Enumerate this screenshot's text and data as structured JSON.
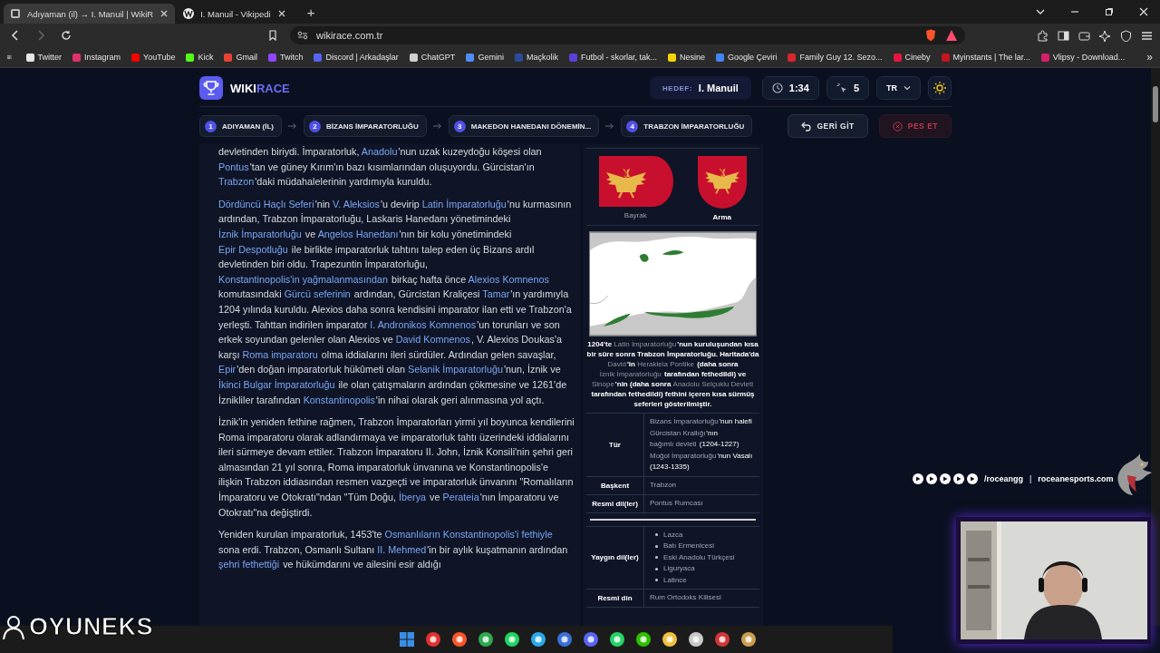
{
  "browser": {
    "tabs": [
      {
        "title": "Adıyaman (il) → I. Manuil | WikiR",
        "kind": "race",
        "selected": true
      },
      {
        "title": "I. Manuil - Vikipedi",
        "kind": "wiki",
        "selected": false
      }
    ],
    "new_tab": "+",
    "address": "wikirace.com.tr",
    "bookmarks": [
      {
        "label": "Twitter",
        "color": "#e7e7e7"
      },
      {
        "label": "Instagram",
        "color": "#e1306c"
      },
      {
        "label": "YouTube",
        "color": "#ff0000"
      },
      {
        "label": "Kick",
        "color": "#53fc18"
      },
      {
        "label": "Gmail",
        "color": "#ea4335"
      },
      {
        "label": "Twitch",
        "color": "#9146ff"
      },
      {
        "label": "Discord | Arkadaşlar",
        "color": "#5865f2"
      },
      {
        "label": "ChatGPT",
        "color": "#d0d0d0"
      },
      {
        "label": "Gemini",
        "color": "#4f8df7"
      },
      {
        "label": "Maçkolik",
        "color": "#2b4c9b"
      },
      {
        "label": "Futbol - skorlar, tak...",
        "color": "#5b3fd6"
      },
      {
        "label": "Nesine",
        "color": "#f5d20a"
      },
      {
        "label": "Google Çeviri",
        "color": "#4285f4"
      },
      {
        "label": "Family Guy 12. Sezo...",
        "color": "#d7262f"
      },
      {
        "label": "Cineby",
        "color": "#e5173f"
      },
      {
        "label": "Myinstants | The lar...",
        "color": "#c4161c"
      },
      {
        "label": "Vlipsy - Download...",
        "color": "#d61f6b"
      }
    ],
    "more": "»"
  },
  "app": {
    "logo": {
      "prefix": "WIKI",
      "suffix": "RACE"
    },
    "target": {
      "label": "HEDEF:",
      "value": "I. Manuil"
    },
    "timer": "1:34",
    "clicks": "5",
    "language": "TR",
    "steps": [
      {
        "number": "1",
        "label": "ADIYAMAN (İL)"
      },
      {
        "number": "2",
        "label": "BİZANS İMPARATORLUĞU"
      },
      {
        "number": "3",
        "label": "MAKEDON HANEDANI DÖNEMİN..."
      },
      {
        "number": "4",
        "label": "TRABZON İMPARATORLUĞU"
      }
    ],
    "back_button": "GERİ GİT",
    "give_up_button": "PES ET"
  },
  "article": {
    "paragraphs": [
      [
        {
          "kind": "text",
          "text": "devletinden biriydi. İmparatorluk, "
        },
        {
          "kind": "link",
          "text": "Anadolu"
        },
        {
          "kind": "text",
          "text": "'nun uzak kuzeydoğu köşesi olan "
        },
        {
          "kind": "link",
          "text": "Pontus"
        },
        {
          "kind": "text",
          "text": "'tan ve güney Kırım'ın bazı kısımlarından oluşuyordu. Gürcistan'ın "
        },
        {
          "kind": "link",
          "text": "Trabzon"
        },
        {
          "kind": "text",
          "text": "'daki müdahalelerinin yardımıyla kuruldu."
        }
      ],
      [
        {
          "kind": "link",
          "text": "Dördüncü Haçlı Seferi"
        },
        {
          "kind": "text",
          "text": "'nin "
        },
        {
          "kind": "link",
          "text": "V. Aleksios"
        },
        {
          "kind": "text",
          "text": "'u devirip "
        },
        {
          "kind": "link",
          "text": "Latin İmparatorluğu"
        },
        {
          "kind": "text",
          "text": "'nu kurmasının ardından, Trabzon İmparatorluğu, Laskaris Hanedanı yönetimindeki "
        },
        {
          "kind": "link",
          "text": "İznik İmparatorluğu"
        },
        {
          "kind": "text",
          "text": " ve "
        },
        {
          "kind": "link",
          "text": "Angelos Hanedanı"
        },
        {
          "kind": "text",
          "text": "'nın bir kolu yönetimindeki "
        },
        {
          "kind": "link",
          "text": "Epir Despotluğu"
        },
        {
          "kind": "text",
          "text": " ile birlikte imparatorluk tahtını talep eden üç Bizans ardıl devletinden biri oldu. Trapezuntin İmparatorluğu, "
        },
        {
          "kind": "link",
          "text": "Konstantinopolis'in yağmalanmasından"
        },
        {
          "kind": "text",
          "text": " birkaç hafta önce "
        },
        {
          "kind": "link",
          "text": "Alexios Komnenos"
        },
        {
          "kind": "text",
          "text": " komutasındaki "
        },
        {
          "kind": "link",
          "text": "Gürcü seferinin"
        },
        {
          "kind": "text",
          "text": " ardından, Gürcistan Kraliçesi "
        },
        {
          "kind": "link",
          "text": "Tamar"
        },
        {
          "kind": "text",
          "text": "'ın yardımıyla 1204 yılında kuruldu. Alexios daha sonra kendisini imparator ilan etti ve Trabzon'a yerleşti. Tahttan indirilen imparator "
        },
        {
          "kind": "link",
          "text": "I. Andronikos Komnenos"
        },
        {
          "kind": "text",
          "text": "'un torunları ve son erkek soyundan gelenler olan Alexios ve "
        },
        {
          "kind": "link",
          "text": "David Komnenos"
        },
        {
          "kind": "text",
          "text": ", V. Alexios Doukas'a karşı "
        },
        {
          "kind": "link",
          "text": "Roma imparatoru"
        },
        {
          "kind": "text",
          "text": " olma iddialarını ileri sürdüler. Ardından gelen savaşlar, "
        },
        {
          "kind": "link",
          "text": "Epir"
        },
        {
          "kind": "text",
          "text": "'den doğan imparatorluk hükûmeti olan "
        },
        {
          "kind": "link",
          "text": "Selanik İmparatorluğu"
        },
        {
          "kind": "text",
          "text": "'nun, İznik ve "
        },
        {
          "kind": "link",
          "text": "İkinci Bulgar İmparatorluğu"
        },
        {
          "kind": "text",
          "text": " ile olan çatışmaların ardından çökmesine ve 1261'de İznikliler tarafından "
        },
        {
          "kind": "link",
          "text": "Konstantinopolis"
        },
        {
          "kind": "text",
          "text": "'in nihai olarak geri alınmasına yol açtı."
        }
      ],
      [
        {
          "kind": "text",
          "text": "İznik'in yeniden fethine rağmen, Trabzon İmparatorları yirmi yıl boyunca kendilerini Roma imparatoru olarak adlandırmaya ve imparatorluk tahtı üzerindeki iddialarını ileri sürmeye devam ettiler. Trabzon İmparatoru II. John, İznik Konsili'nin şehri geri almasından 21 yıl sonra, Roma imparatorluk ünvanına ve Konstantinopolis'e ilişkin Trabzon iddiasından resmen vazgeçti ve imparatorluk ünvanını \"Romalıların İmparatoru ve Otokratı\"ndan \"Tüm Doğu, "
        },
        {
          "kind": "link",
          "text": "İberya"
        },
        {
          "kind": "text",
          "text": " ve "
        },
        {
          "kind": "link",
          "text": "Perateia"
        },
        {
          "kind": "text",
          "text": "'nın İmparatoru ve Otokratı\"na değiştirdi."
        }
      ],
      [
        {
          "kind": "text",
          "text": "Yeniden kurulan imparatorluk, 1453'te "
        },
        {
          "kind": "link",
          "text": "Osmanlıların Konstantinopolis'i fethiyle"
        },
        {
          "kind": "text",
          "text": " sona erdi. Trabzon, Osmanlı Sultanı "
        },
        {
          "kind": "link",
          "text": "II. Mehmed"
        },
        {
          "kind": "text",
          "text": "'in bir aylık kuşatmanın ardından "
        },
        {
          "kind": "link",
          "text": "şehri fethettiği"
        },
        {
          "kind": "text",
          "text": " ve hükümdarını ve ailesini esir aldığı"
        }
      ]
    ]
  },
  "infobox": {
    "emblems": [
      {
        "kind": "flag",
        "caption": "Bayrak",
        "selected": false
      },
      {
        "kind": "arms",
        "caption": "Arma",
        "selected": true
      }
    ],
    "map": {
      "kind": "picture",
      "caption": [
        {
          "kind": "text",
          "text": "1204'te "
        },
        {
          "kind": "link",
          "text": "Latin İmparatorluğu"
        },
        {
          "kind": "text",
          "text": "'nun kuruluşundan kısa bir süre sonra Trabzon İmparatorluğu. Haritada'da "
        },
        {
          "kind": "link",
          "text": "David"
        },
        {
          "kind": "text",
          "text": "'in "
        },
        {
          "kind": "link",
          "text": "Herakleia Pontike"
        },
        {
          "kind": "text",
          "text": " (daha sonra "
        },
        {
          "kind": "link",
          "text": "İznik İmparatorluğu"
        },
        {
          "kind": "text",
          "text": " tarafından fethedildi) ve "
        },
        {
          "kind": "link",
          "text": "Sinope"
        },
        {
          "kind": "text",
          "text": "'nin (daha sonra "
        },
        {
          "kind": "link",
          "text": "Anadolu Selçuklu Devleti"
        },
        {
          "kind": "text",
          "text": " tarafından fethedildi) fethini içeren kısa sürmüş seferleri gösterilmiştir."
        }
      ]
    },
    "rows": [
      {
        "kind": "field",
        "label": "Tür",
        "lines": [
          [
            {
              "kind": "link",
              "text": "Bizans İmparatorluğu"
            },
            {
              "kind": "text",
              "text": "'nun halefi"
            }
          ],
          [
            {
              "kind": "link",
              "text": "Gürcistan Krallığı"
            },
            {
              "kind": "text",
              "text": "'nın "
            },
            {
              "kind": "link",
              "text": "bağımlı devleti"
            },
            {
              "kind": "text",
              "text": " (1204-1227)"
            }
          ],
          [
            {
              "kind": "link",
              "text": "Moğol İmparatorluğu"
            },
            {
              "kind": "text",
              "text": "'nun Vasalı (1243-1335)"
            }
          ]
        ]
      },
      {
        "kind": "field",
        "label": "Başkent",
        "lines": [
          [
            {
              "kind": "link",
              "text": "Trabzon"
            }
          ]
        ]
      },
      {
        "kind": "field",
        "label": "Resmî dil(ler)",
        "lines": [
          [
            {
              "kind": "link",
              "text": "Pontus Rumcası"
            }
          ]
        ]
      },
      {
        "kind": "divider"
      },
      {
        "kind": "list",
        "label": "Yaygın dil(ler)",
        "items": [
          "Lazca",
          "Batı Ermenicesi",
          "Eski Anadolu Türkçesi",
          "Liguryaca",
          "Latince"
        ]
      },
      {
        "kind": "field",
        "label": "Resmî din",
        "lines": [
          [
            {
              "kind": "link",
              "text": "Rum Ortodoks Kilisesi"
            }
          ]
        ]
      }
    ]
  },
  "overlay": {
    "handle": "/roceangg",
    "separator": "|",
    "website": "roceanesports.com",
    "brand": "OYUNEKS"
  },
  "taskbar": {
    "apps": [
      {
        "kind": "start",
        "color": "#3a8ee6"
      },
      {
        "kind": "app",
        "color": "#e0312f"
      },
      {
        "kind": "app",
        "color": "#fb542b"
      },
      {
        "kind": "app",
        "color": "#2da94f"
      },
      {
        "kind": "app",
        "color": "#1ed760"
      },
      {
        "kind": "app",
        "color": "#29a9eb"
      },
      {
        "kind": "app",
        "color": "#3b6fd8"
      },
      {
        "kind": "app",
        "color": "#5865f2"
      },
      {
        "kind": "app",
        "color": "#25d366"
      },
      {
        "kind": "app",
        "color": "#2dc100"
      },
      {
        "kind": "app",
        "color": "#f0c03e"
      },
      {
        "kind": "app",
        "color": "#c9c9c9"
      },
      {
        "kind": "app",
        "color": "#d13639"
      },
      {
        "kind": "app",
        "color": "#c8a04f"
      }
    ]
  }
}
